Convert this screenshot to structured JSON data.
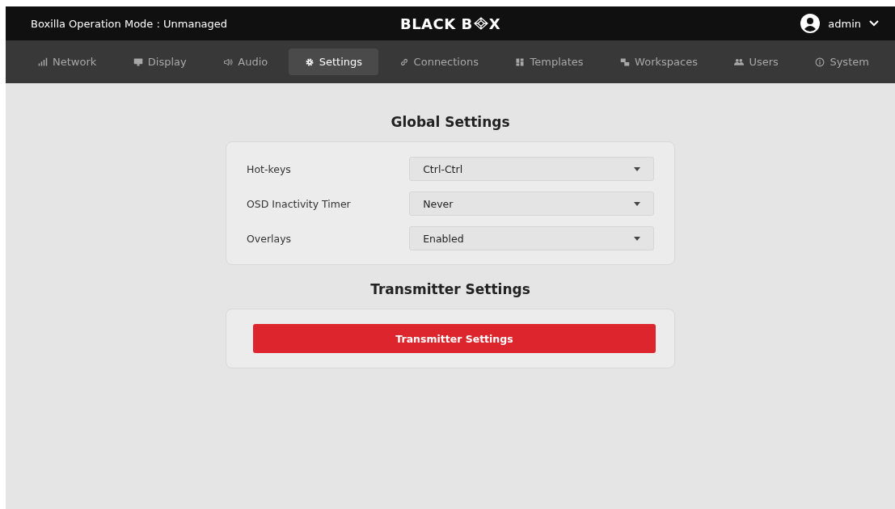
{
  "header": {
    "mode_text": "Boxilla Operation Mode : Unmanaged",
    "logo": [
      "BLACK B",
      "X"
    ],
    "user": "admin"
  },
  "tabs": [
    {
      "label": "Network",
      "kind": "signal",
      "selected": false
    },
    {
      "label": "Display",
      "kind": "monitor",
      "selected": false
    },
    {
      "label": "Audio",
      "kind": "speaker",
      "selected": false
    },
    {
      "label": "Settings",
      "kind": "gear",
      "selected": true
    },
    {
      "label": "Connections",
      "kind": "link",
      "selected": false
    },
    {
      "label": "Templates",
      "kind": "grid",
      "selected": false
    },
    {
      "label": "Workspaces",
      "kind": "windows",
      "selected": false
    },
    {
      "label": "Users",
      "kind": "users",
      "selected": false
    },
    {
      "label": "System",
      "kind": "info",
      "selected": false
    }
  ],
  "global_settings": {
    "title": "Global Settings",
    "rows": [
      {
        "label": "Hot-keys",
        "value": "Ctrl-Ctrl"
      },
      {
        "label": "OSD Inactivity Timer",
        "value": "Never"
      },
      {
        "label": "Overlays",
        "value": "Enabled"
      }
    ]
  },
  "transmitter_settings": {
    "title": "Transmitter Settings",
    "button": "Transmitter Settings"
  }
}
